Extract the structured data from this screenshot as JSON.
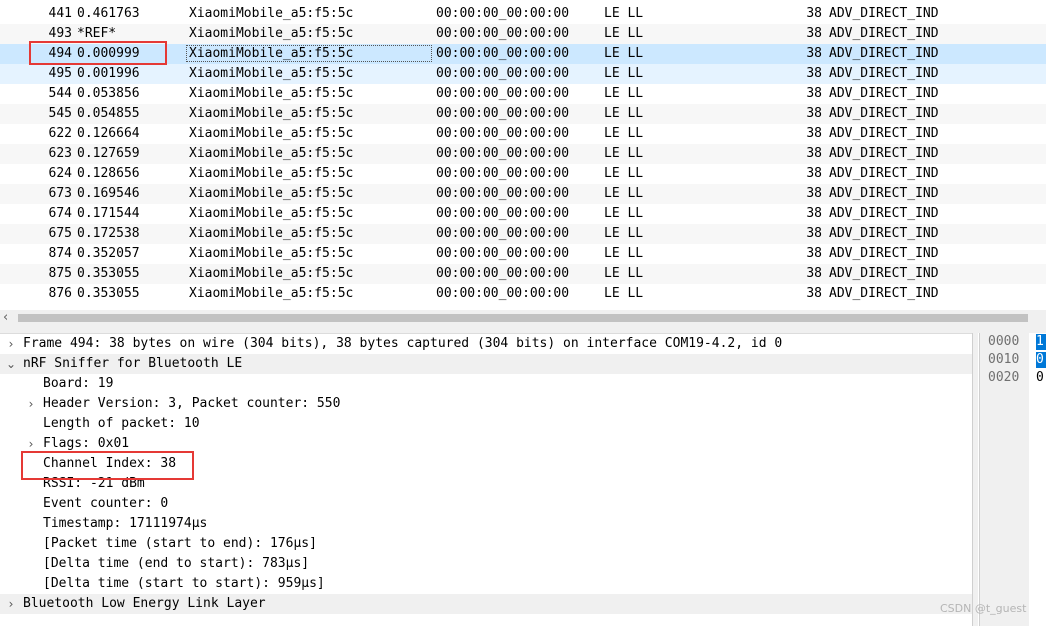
{
  "packet_list": {
    "rows": [
      {
        "no": "441",
        "time": "0.461763",
        "source": "XiaomiMobile_a5:f5:5c",
        "destination": "00:00:00_00:00:00",
        "protocol": "LE LL",
        "length": "38",
        "info": "ADV_DIRECT_IND"
      },
      {
        "no": "493",
        "time": "*REF*",
        "source": "XiaomiMobile_a5:f5:5c",
        "destination": "00:00:00_00:00:00",
        "protocol": "LE LL",
        "length": "38",
        "info": "ADV_DIRECT_IND"
      },
      {
        "no": "494",
        "time": "0.000999",
        "source": "XiaomiMobile_a5:f5:5c",
        "destination": "00:00:00_00:00:00",
        "protocol": "LE LL",
        "length": "38",
        "info": "ADV_DIRECT_IND"
      },
      {
        "no": "495",
        "time": "0.001996",
        "source": "XiaomiMobile_a5:f5:5c",
        "destination": "00:00:00_00:00:00",
        "protocol": "LE LL",
        "length": "38",
        "info": "ADV_DIRECT_IND"
      },
      {
        "no": "544",
        "time": "0.053856",
        "source": "XiaomiMobile_a5:f5:5c",
        "destination": "00:00:00_00:00:00",
        "protocol": "LE LL",
        "length": "38",
        "info": "ADV_DIRECT_IND"
      },
      {
        "no": "545",
        "time": "0.054855",
        "source": "XiaomiMobile_a5:f5:5c",
        "destination": "00:00:00_00:00:00",
        "protocol": "LE LL",
        "length": "38",
        "info": "ADV_DIRECT_IND"
      },
      {
        "no": "622",
        "time": "0.126664",
        "source": "XiaomiMobile_a5:f5:5c",
        "destination": "00:00:00_00:00:00",
        "protocol": "LE LL",
        "length": "38",
        "info": "ADV_DIRECT_IND"
      },
      {
        "no": "623",
        "time": "0.127659",
        "source": "XiaomiMobile_a5:f5:5c",
        "destination": "00:00:00_00:00:00",
        "protocol": "LE LL",
        "length": "38",
        "info": "ADV_DIRECT_IND"
      },
      {
        "no": "624",
        "time": "0.128656",
        "source": "XiaomiMobile_a5:f5:5c",
        "destination": "00:00:00_00:00:00",
        "protocol": "LE LL",
        "length": "38",
        "info": "ADV_DIRECT_IND"
      },
      {
        "no": "673",
        "time": "0.169546",
        "source": "XiaomiMobile_a5:f5:5c",
        "destination": "00:00:00_00:00:00",
        "protocol": "LE LL",
        "length": "38",
        "info": "ADV_DIRECT_IND"
      },
      {
        "no": "674",
        "time": "0.171544",
        "source": "XiaomiMobile_a5:f5:5c",
        "destination": "00:00:00_00:00:00",
        "protocol": "LE LL",
        "length": "38",
        "info": "ADV_DIRECT_IND"
      },
      {
        "no": "675",
        "time": "0.172538",
        "source": "XiaomiMobile_a5:f5:5c",
        "destination": "00:00:00_00:00:00",
        "protocol": "LE LL",
        "length": "38",
        "info": "ADV_DIRECT_IND"
      },
      {
        "no": "874",
        "time": "0.352057",
        "source": "XiaomiMobile_a5:f5:5c",
        "destination": "00:00:00_00:00:00",
        "protocol": "LE LL",
        "length": "38",
        "info": "ADV_DIRECT_IND"
      },
      {
        "no": "875",
        "time": "0.353055",
        "source": "XiaomiMobile_a5:f5:5c",
        "destination": "00:00:00_00:00:00",
        "protocol": "LE LL",
        "length": "38",
        "info": "ADV_DIRECT_IND"
      },
      {
        "no": "876",
        "time": "0.353055",
        "source": "XiaomiMobile_a5:f5:5c",
        "destination": "00:00:00_00:00:00",
        "protocol": "LE LL",
        "length": "38",
        "info": "ADV_DIRECT_IND"
      }
    ],
    "selected_no": "494",
    "related_no": "495",
    "scroll_left_icon": "chevron-left-icon"
  },
  "details": {
    "lines": [
      {
        "text": "Frame 494: 38 bytes on wire (304 bits), 38 bytes captured (304 bits) on interface COM19-4.2, id 0",
        "expander": "collapsed"
      },
      {
        "text": "nRF Sniffer for Bluetooth LE",
        "expander": "expanded"
      },
      {
        "text": "Board: 19",
        "expander": "none"
      },
      {
        "text": "Header Version: 3, Packet counter: 550",
        "expander": "collapsed"
      },
      {
        "text": "Length of packet: 10",
        "expander": "none"
      },
      {
        "text": "Flags: 0x01",
        "expander": "collapsed"
      },
      {
        "text": "Channel Index: 38",
        "expander": "none"
      },
      {
        "text": "RSSI: -21 dBm",
        "expander": "none"
      },
      {
        "text": "Event counter: 0",
        "expander": "none"
      },
      {
        "text": "Timestamp: 17111974µs",
        "expander": "none"
      },
      {
        "text": "[Packet time (start to end): 176µs]",
        "expander": "none"
      },
      {
        "text": "[Delta time (end to start): 783µs]",
        "expander": "none"
      },
      {
        "text": "[Delta time (start to start): 959µs]",
        "expander": "none"
      },
      {
        "text": "Bluetooth Low Energy Link Layer",
        "expander": "collapsed"
      }
    ],
    "expander_icons": {
      "collapsed": "›",
      "expanded": "⌄"
    }
  },
  "bytes": {
    "rows": [
      {
        "offset": "0000",
        "hex": "1",
        "selected": true
      },
      {
        "offset": "0010",
        "hex": "0",
        "selected": true
      },
      {
        "offset": "0020",
        "hex": "0",
        "selected": false
      }
    ]
  },
  "colors": {
    "selected_row": "#cce8ff",
    "related_row": "#e5f3ff",
    "alt_row": "#f7f7f7",
    "annotation": "#e53935",
    "byte_highlight": "#0078d7"
  },
  "watermark": "CSDN @t_guest"
}
